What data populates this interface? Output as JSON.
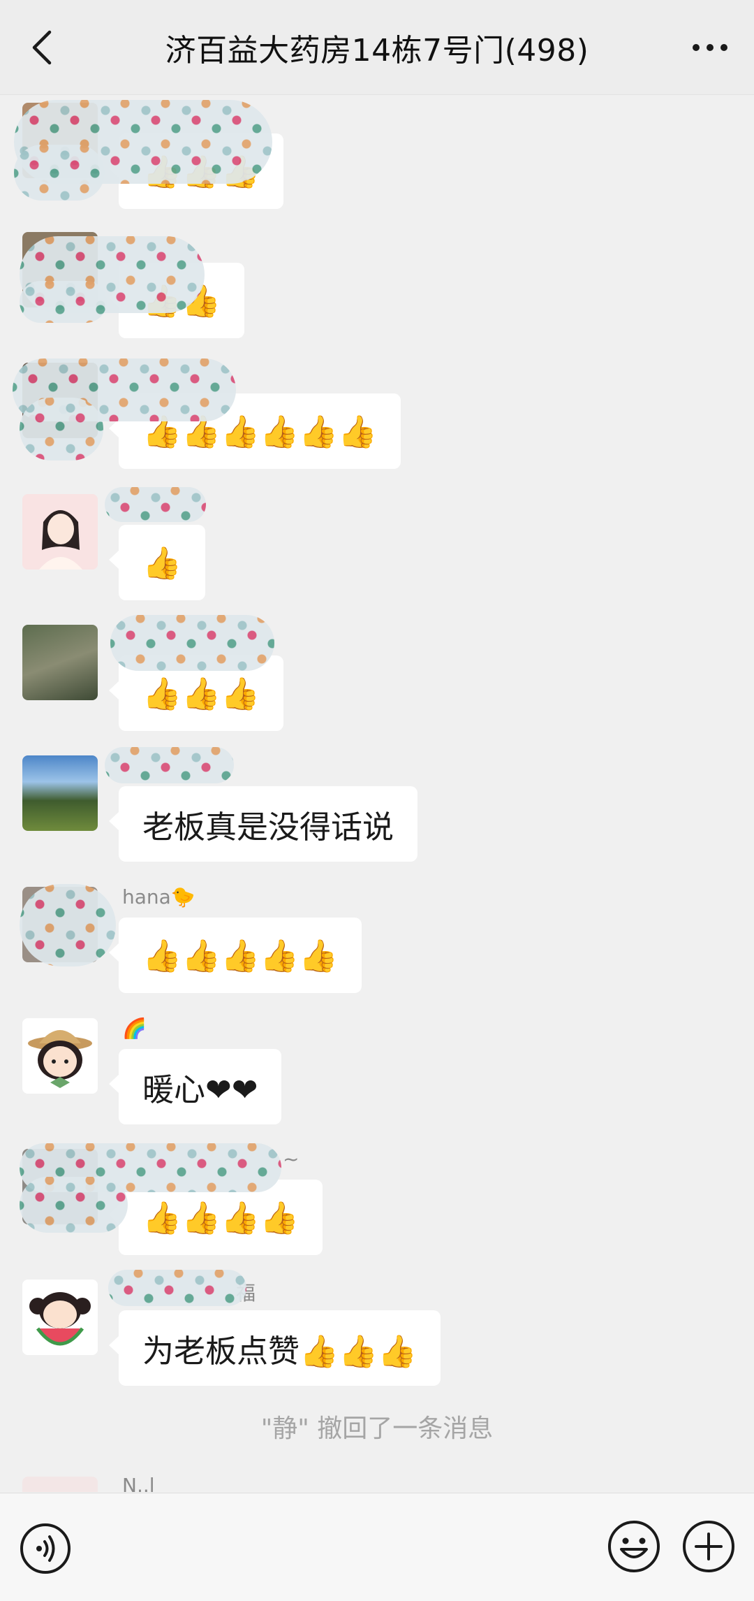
{
  "header": {
    "title": "济百益大药房14栋7号门(498)"
  },
  "messages": [
    {
      "sender": "",
      "text": "👍👍👍"
    },
    {
      "sender": "",
      "text": "👍👍"
    },
    {
      "sender": "",
      "text": "👍👍👍👍👍👍"
    },
    {
      "sender": "",
      "text": "👍"
    },
    {
      "sender": "",
      "text": "👍👍👍"
    },
    {
      "sender": "",
      "text": "老板真是没得话说"
    },
    {
      "sender": "hana🐤",
      "text": "👍👍👍👍👍"
    },
    {
      "sender": "🌈",
      "text": "暖心❤❤"
    },
    {
      "sender": "~",
      "text": "👍👍👍👍"
    },
    {
      "sender": "福",
      "text": "为老板点赞👍👍👍"
    }
  ],
  "system": {
    "recall_text": "\"静\" 撤回了一条消息"
  },
  "partial_sender": "N..l",
  "icons": {
    "back": "chevron-left-icon",
    "more": "more-dots-icon",
    "voice": "voice-icon",
    "emoji": "emoji-smile-icon",
    "plus": "plus-icon"
  },
  "colors": {
    "background": "#f0f0f0",
    "header": "#ededed",
    "bubble": "#ffffff",
    "muted_text": "#a5a5a5"
  }
}
